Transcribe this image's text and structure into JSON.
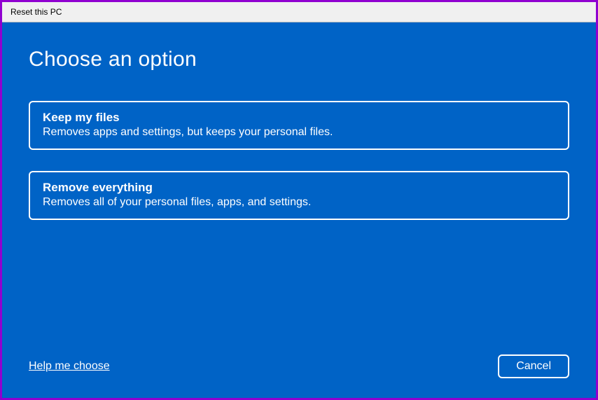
{
  "window": {
    "title": "Reset this PC"
  },
  "heading": "Choose an option",
  "options": [
    {
      "title": "Keep my files",
      "description": "Removes apps and settings, but keeps your personal files."
    },
    {
      "title": "Remove everything",
      "description": "Removes all of your personal files, apps, and settings."
    }
  ],
  "footer": {
    "help_label": "Help me choose",
    "cancel_label": "Cancel"
  }
}
